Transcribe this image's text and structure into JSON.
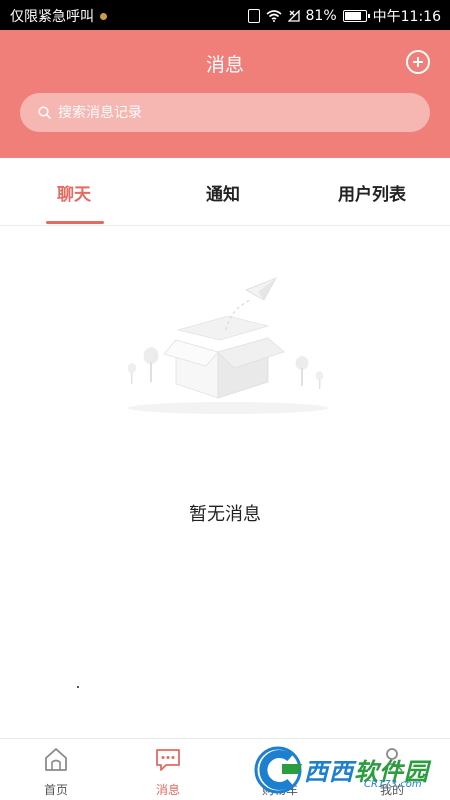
{
  "status_bar": {
    "carrier": "仅限紧急呼叫",
    "battery": "81%",
    "battery_level": 0.81,
    "time": "中午11:16",
    "icons": [
      "vibrate-icon",
      "wifi-icon",
      "no-signal-icon",
      "battery-icon"
    ]
  },
  "header": {
    "title": "消息",
    "add_icon": "plus-circle-icon"
  },
  "search": {
    "placeholder": "搜索消息记录",
    "icon": "search-icon"
  },
  "tabs": [
    {
      "label": "聊天",
      "active": true
    },
    {
      "label": "通知",
      "active": false
    },
    {
      "label": "用户列表",
      "active": false
    }
  ],
  "empty_state": {
    "message": "暂无消息",
    "illustration": "empty-box-paper-plane"
  },
  "bottom_nav": [
    {
      "label": "首页",
      "icon": "home-icon",
      "active": false
    },
    {
      "label": "消息",
      "icon": "chat-icon",
      "active": true
    },
    {
      "label": "购物车",
      "icon": "cart-icon",
      "active": false
    },
    {
      "label": "我的",
      "icon": "profile-icon",
      "active": false
    }
  ],
  "watermark": {
    "text_1": "西西",
    "text_2": "软件园",
    "sub": "CR173.com"
  },
  "colors": {
    "accent": "#f07e79",
    "active_text": "#e56a62",
    "search_bg": "#f6b6b2"
  }
}
